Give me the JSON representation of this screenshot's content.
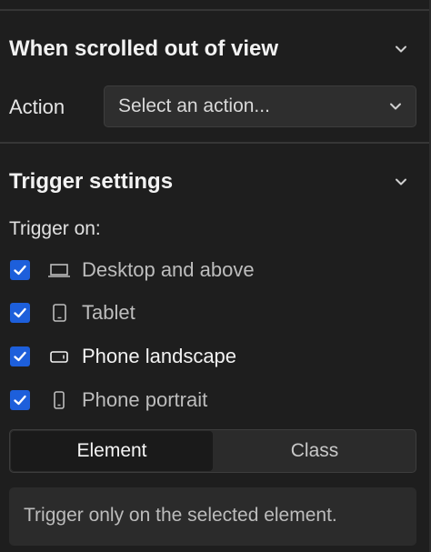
{
  "scroll_section": {
    "title": "When scrolled out of view",
    "action_label": "Action",
    "action_select": {
      "value": "Select an action...",
      "icon": "chevron-down-icon"
    },
    "collapse_icon": "chevron-down-icon"
  },
  "trigger_section": {
    "title": "Trigger settings",
    "collapse_icon": "chevron-down-icon",
    "trigger_on_label": "Trigger on:",
    "devices": [
      {
        "label": "Desktop and above",
        "icon": "desktop-icon",
        "checked": true
      },
      {
        "label": "Tablet",
        "icon": "tablet-icon",
        "checked": true
      },
      {
        "label": "Phone landscape",
        "icon": "phone-landscape-icon",
        "checked": true
      },
      {
        "label": "Phone portrait",
        "icon": "phone-portrait-icon",
        "checked": true
      }
    ],
    "target_toggle": {
      "options": [
        "Element",
        "Class"
      ],
      "selected": "Element"
    },
    "hint": "Trigger only on the selected element."
  },
  "colors": {
    "background": "#1e1e1e",
    "checkbox": "#1d5fdb",
    "control_bg": "#2e2e2e"
  }
}
